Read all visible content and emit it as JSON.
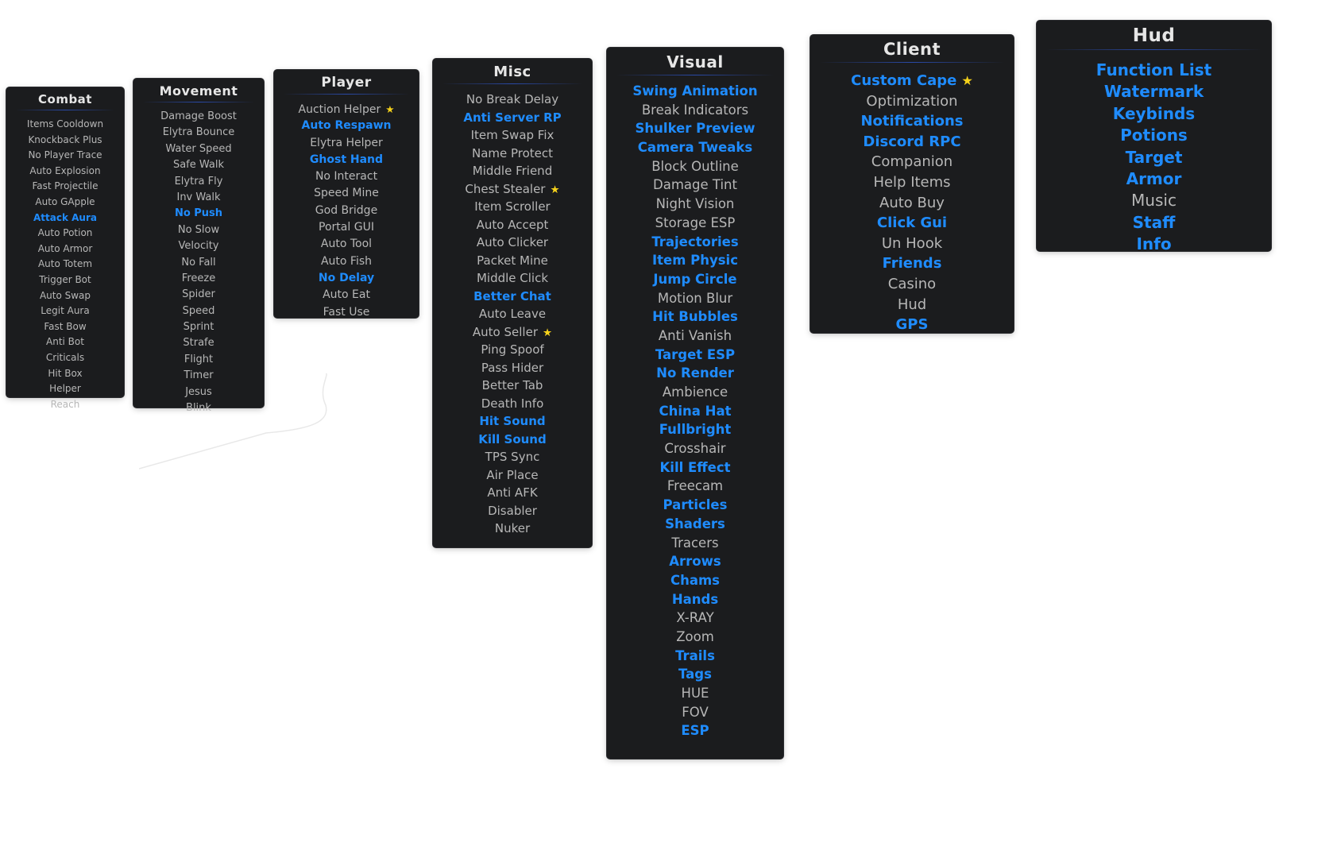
{
  "panels": [
    {
      "title": "Combat",
      "items": [
        {
          "label": "Items Cooldown",
          "active": false
        },
        {
          "label": "Knockback Plus",
          "active": false
        },
        {
          "label": "No Player Trace",
          "active": false
        },
        {
          "label": "Auto Explosion",
          "active": false
        },
        {
          "label": "Fast Projectile",
          "active": false
        },
        {
          "label": "Auto GApple",
          "active": false
        },
        {
          "label": "Attack Aura",
          "active": true
        },
        {
          "label": "Auto Potion",
          "active": false
        },
        {
          "label": "Auto Armor",
          "active": false
        },
        {
          "label": "Auto Totem",
          "active": false
        },
        {
          "label": "Trigger Bot",
          "active": false
        },
        {
          "label": "Auto Swap",
          "active": false
        },
        {
          "label": "Legit Aura",
          "active": false
        },
        {
          "label": "Fast Bow",
          "active": false
        },
        {
          "label": "Anti Bot",
          "active": false
        },
        {
          "label": "Criticals",
          "active": false
        },
        {
          "label": "Hit Box",
          "active": false
        },
        {
          "label": "Helper",
          "active": false
        },
        {
          "label": "Reach",
          "active": false
        }
      ]
    },
    {
      "title": "Movement",
      "items": [
        {
          "label": "Damage Boost",
          "active": false
        },
        {
          "label": "Elytra Bounce",
          "active": false
        },
        {
          "label": "Water Speed",
          "active": false
        },
        {
          "label": "Safe Walk",
          "active": false
        },
        {
          "label": "Elytra Fly",
          "active": false
        },
        {
          "label": "Inv Walk",
          "active": false
        },
        {
          "label": "No Push",
          "active": true
        },
        {
          "label": "No Slow",
          "active": false
        },
        {
          "label": "Velocity",
          "active": false
        },
        {
          "label": "No Fall",
          "active": false
        },
        {
          "label": "Freeze",
          "active": false
        },
        {
          "label": "Spider",
          "active": false
        },
        {
          "label": "Speed",
          "active": false
        },
        {
          "label": "Sprint",
          "active": false
        },
        {
          "label": "Strafe",
          "active": false
        },
        {
          "label": "Flight",
          "active": false
        },
        {
          "label": "Timer",
          "active": false
        },
        {
          "label": "Jesus",
          "active": false
        },
        {
          "label": "Blink",
          "active": false
        }
      ]
    },
    {
      "title": "Player",
      "items": [
        {
          "label": "Auction Helper",
          "active": false,
          "favorite": true
        },
        {
          "label": "Auto Respawn",
          "active": true
        },
        {
          "label": "Elytra Helper",
          "active": false
        },
        {
          "label": "Ghost Hand",
          "active": true
        },
        {
          "label": "No Interact",
          "active": false
        },
        {
          "label": "Speed Mine",
          "active": false
        },
        {
          "label": "God Bridge",
          "active": false
        },
        {
          "label": "Portal GUI",
          "active": false
        },
        {
          "label": "Auto Tool",
          "active": false
        },
        {
          "label": "Auto Fish",
          "active": false
        },
        {
          "label": "No Delay",
          "active": true
        },
        {
          "label": "Auto Eat",
          "active": false
        },
        {
          "label": "Fast Use",
          "active": false
        }
      ]
    },
    {
      "title": "Misc",
      "items": [
        {
          "label": "No Break Delay",
          "active": false
        },
        {
          "label": "Anti Server RP",
          "active": true
        },
        {
          "label": "Item Swap Fix",
          "active": false
        },
        {
          "label": "Name Protect",
          "active": false
        },
        {
          "label": "Middle Friend",
          "active": false
        },
        {
          "label": "Chest Stealer",
          "active": false,
          "favorite": true
        },
        {
          "label": "Item Scroller",
          "active": false
        },
        {
          "label": "Auto Accept",
          "active": false
        },
        {
          "label": "Auto Clicker",
          "active": false
        },
        {
          "label": "Packet Mine",
          "active": false
        },
        {
          "label": "Middle Click",
          "active": false
        },
        {
          "label": "Better Chat",
          "active": true
        },
        {
          "label": "Auto Leave",
          "active": false
        },
        {
          "label": "Auto Seller",
          "active": false,
          "favorite": true
        },
        {
          "label": "Ping Spoof",
          "active": false
        },
        {
          "label": "Pass Hider",
          "active": false
        },
        {
          "label": "Better Tab",
          "active": false
        },
        {
          "label": "Death Info",
          "active": false
        },
        {
          "label": "Hit Sound",
          "active": true
        },
        {
          "label": "Kill Sound",
          "active": true
        },
        {
          "label": "TPS Sync",
          "active": false
        },
        {
          "label": "Air Place",
          "active": false
        },
        {
          "label": "Anti AFK",
          "active": false
        },
        {
          "label": "Disabler",
          "active": false
        },
        {
          "label": "Nuker",
          "active": false
        }
      ]
    },
    {
      "title": "Visual",
      "items": [
        {
          "label": "Swing Animation",
          "active": true
        },
        {
          "label": "Break Indicators",
          "active": false
        },
        {
          "label": "Shulker Preview",
          "active": true
        },
        {
          "label": "Camera Tweaks",
          "active": true
        },
        {
          "label": "Block Outline",
          "active": false
        },
        {
          "label": "Damage Tint",
          "active": false
        },
        {
          "label": "Night Vision",
          "active": false
        },
        {
          "label": "Storage ESP",
          "active": false
        },
        {
          "label": "Trajectories",
          "active": true
        },
        {
          "label": "Item Physic",
          "active": true
        },
        {
          "label": "Jump Circle",
          "active": true
        },
        {
          "label": "Motion Blur",
          "active": false
        },
        {
          "label": "Hit Bubbles",
          "active": true
        },
        {
          "label": "Anti Vanish",
          "active": false
        },
        {
          "label": "Target ESP",
          "active": true
        },
        {
          "label": "No Render",
          "active": true
        },
        {
          "label": "Ambience",
          "active": false
        },
        {
          "label": "China Hat",
          "active": true
        },
        {
          "label": "Fullbright",
          "active": true
        },
        {
          "label": "Crosshair",
          "active": false
        },
        {
          "label": "Kill Effect",
          "active": true
        },
        {
          "label": "Freecam",
          "active": false
        },
        {
          "label": "Particles",
          "active": true
        },
        {
          "label": "Shaders",
          "active": true
        },
        {
          "label": "Tracers",
          "active": false
        },
        {
          "label": "Arrows",
          "active": true
        },
        {
          "label": "Chams",
          "active": true
        },
        {
          "label": "Hands",
          "active": true
        },
        {
          "label": "X-RAY",
          "active": false
        },
        {
          "label": "Zoom",
          "active": false
        },
        {
          "label": "Trails",
          "active": true
        },
        {
          "label": "Tags",
          "active": true
        },
        {
          "label": "HUE",
          "active": false
        },
        {
          "label": "FOV",
          "active": false
        },
        {
          "label": "ESP",
          "active": true
        }
      ]
    },
    {
      "title": "Client",
      "items": [
        {
          "label": "Custom Cape",
          "active": true,
          "favorite": true
        },
        {
          "label": "Optimization",
          "active": false
        },
        {
          "label": "Notifications",
          "active": true
        },
        {
          "label": "Discord RPC",
          "active": true
        },
        {
          "label": "Companion",
          "active": false
        },
        {
          "label": "Help Items",
          "active": false
        },
        {
          "label": "Auto Buy",
          "active": false
        },
        {
          "label": "Click Gui",
          "active": true
        },
        {
          "label": "Un Hook",
          "active": false
        },
        {
          "label": "Friends",
          "active": true
        },
        {
          "label": "Casino",
          "active": false
        },
        {
          "label": "Hud",
          "active": false
        },
        {
          "label": "GPS",
          "active": true
        }
      ]
    },
    {
      "title": "Hud",
      "items": [
        {
          "label": "Function List",
          "active": true
        },
        {
          "label": "Watermark",
          "active": true
        },
        {
          "label": "Keybinds",
          "active": true
        },
        {
          "label": "Potions",
          "active": true
        },
        {
          "label": "Target",
          "active": true
        },
        {
          "label": "Armor",
          "active": true
        },
        {
          "label": "Music",
          "active": false
        },
        {
          "label": "Staff",
          "active": true
        },
        {
          "label": "Info",
          "active": true
        }
      ]
    }
  ],
  "colors": {
    "panel_bg": "#1b1c1e",
    "item_inactive": "#b7b7b7",
    "item_active": "#1f8cff",
    "title": "#e6e6e6",
    "favorite_star": "#f6d21b",
    "separator": "#2a4aa8"
  },
  "icons": {
    "favorite": "star-icon"
  }
}
